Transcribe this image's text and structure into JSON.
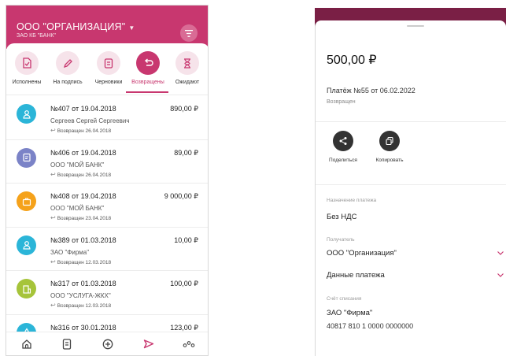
{
  "left": {
    "header": {
      "org_name": "ООО \"ОРГАНИЗАЦИЯ\"",
      "bank_name": "ЗАО КБ \"БАНК\""
    },
    "tabs": [
      {
        "label": "Исполнены",
        "icon": "doc-check-icon"
      },
      {
        "label": "На подпись",
        "icon": "pen-icon"
      },
      {
        "label": "Черновики",
        "icon": "draft-icon"
      },
      {
        "label": "Возвращены",
        "icon": "return-arrow-icon",
        "active": true
      },
      {
        "label": "Ожидают",
        "icon": "hourglass-icon"
      }
    ],
    "documents": [
      {
        "title": "№407 от 19.04.2018",
        "amount": "890,00 ₽",
        "payee": "Сергеев Сергей Сергеевич",
        "status": "Возвращен 26.04.2018",
        "color": "#2bb5d8",
        "icon": "person-icon"
      },
      {
        "title": "№406 от 19.04.2018",
        "amount": "89,00 ₽",
        "payee": "ООО \"МОЙ БАНК\"",
        "status": "Возвращен 26.04.2018",
        "color": "#7b83c7",
        "icon": "document-icon"
      },
      {
        "title": "№408 от 19.04.2018",
        "amount": "9 000,00 ₽",
        "payee": "ООО \"МОЙ БАНК\"",
        "status": "Возвращен 23.04.2018",
        "color": "#f5a21b",
        "icon": "briefcase-icon"
      },
      {
        "title": "№389 от 01.03.2018",
        "amount": "10,00 ₽",
        "payee": "ЗАО \"Фирма\"",
        "status": "Возвращен 12.03.2018",
        "color": "#2bb5d8",
        "icon": "person-icon"
      },
      {
        "title": "№317 от 01.03.2018",
        "amount": "100,00 ₽",
        "payee": "ООО \"УСЛУГА-ЖКХ\"",
        "status": "Возвращен 12.03.2018",
        "color": "#a6c43a",
        "icon": "building-icon"
      },
      {
        "title": "№316 от 30.01.2018",
        "amount": "123,00 ₽",
        "payee": "",
        "status": "",
        "color": "#2bb5d8",
        "icon": "drop-icon"
      }
    ],
    "bottom_nav": [
      "home-icon",
      "documents-icon",
      "add-circle-icon",
      "send-icon",
      "more-icon"
    ]
  },
  "right": {
    "amount_main": "500",
    "amount_cents": ",00 ₽",
    "payment_title": "Платёж №55 от 06.02.2022",
    "payment_status": "Возвращен",
    "actions": [
      {
        "label": "Поделиться",
        "icon": "share-icon"
      },
      {
        "label": "Копировать",
        "icon": "copy-icon"
      }
    ],
    "purpose_label": "Назначение платежа",
    "purpose_value": "Без НДС",
    "recipient_label": "Получатель",
    "recipient_value": "ООО \"Организация\"",
    "payment_data_value": "Данные платежа",
    "account_label": "Счёт списания",
    "account_name": "ЗАО \"Фирма\"",
    "account_number": "40817 810 1 0000 0000000"
  },
  "colors": {
    "brand": "#c8376f",
    "brand_dark": "#7a1f45",
    "tab_bg": "#f6e3ea"
  }
}
